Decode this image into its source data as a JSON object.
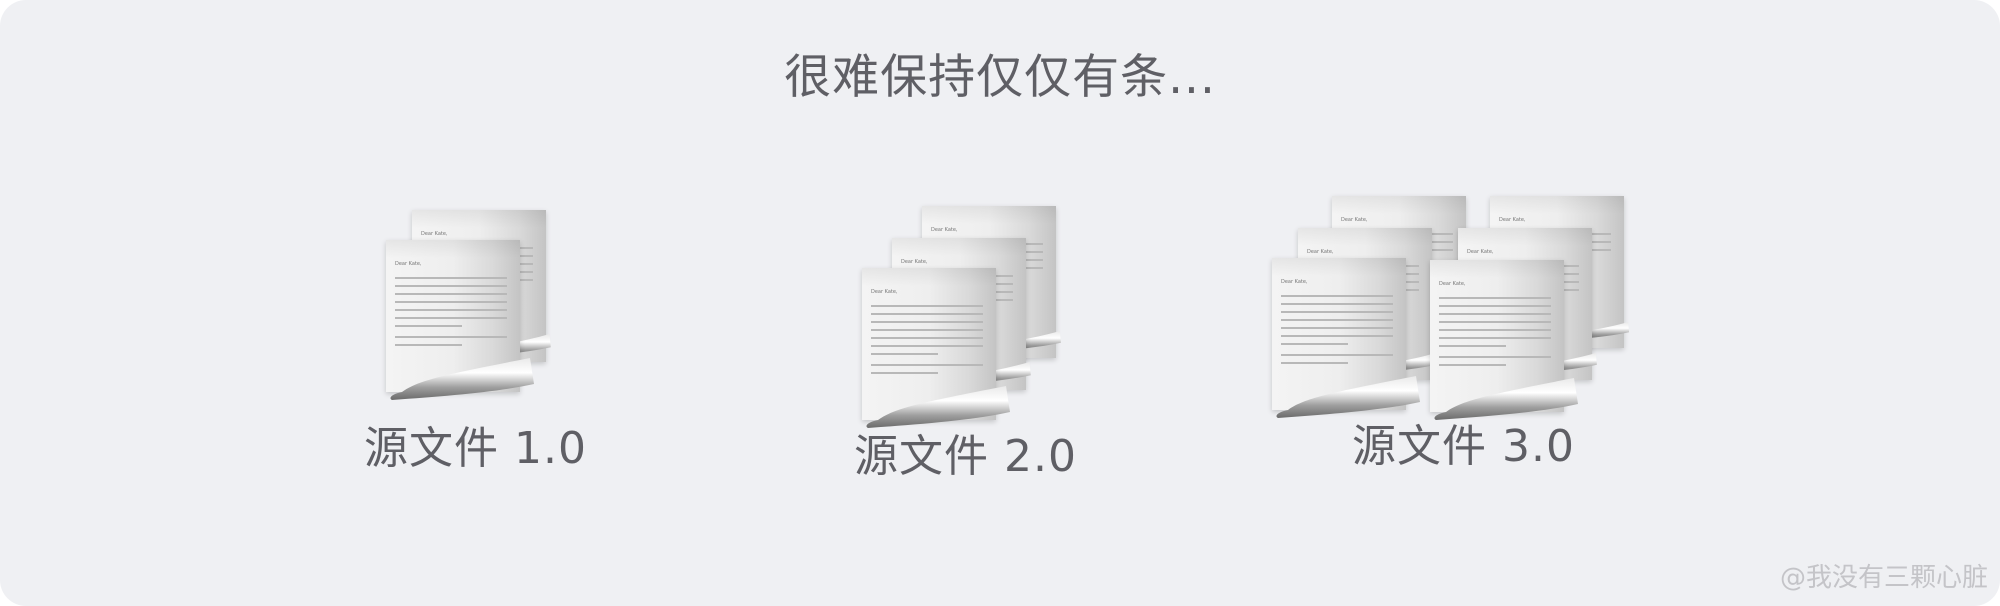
{
  "title": "很难保持仅仅有条...",
  "documents": {
    "greeting": "Dear Kate,"
  },
  "captions": {
    "v1": "源文件 1.0",
    "v2": "源文件 2.0",
    "v3": "源文件 3.0"
  },
  "watermark": "@我没有三颗心脏"
}
